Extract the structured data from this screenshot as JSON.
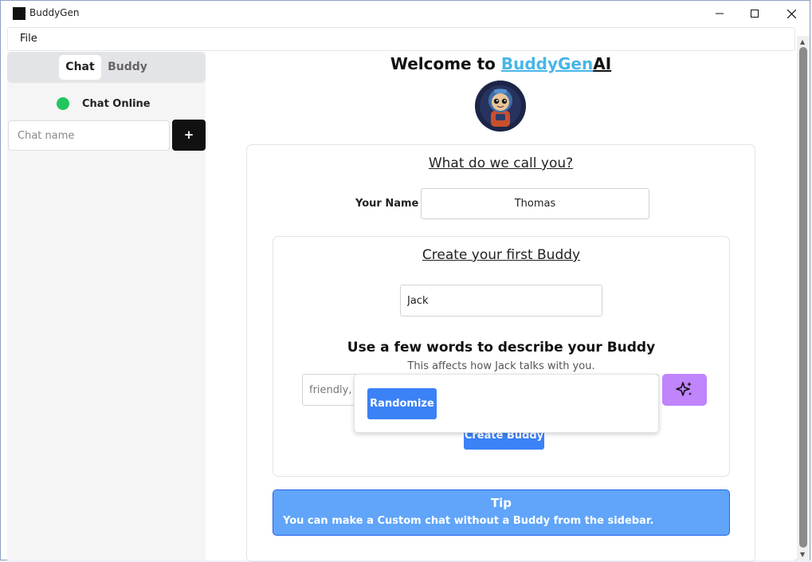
{
  "window": {
    "title": "BuddyGen"
  },
  "menu": {
    "file": "File"
  },
  "sidebar": {
    "tabs": [
      "Chat",
      "Buddy"
    ],
    "status_label": "Chat Online",
    "status_color": "#22c55e",
    "chat_name_placeholder": "Chat name",
    "add_button": "+"
  },
  "main": {
    "welcome_prefix": "Welcome to ",
    "brand_part1": "BuddyGen",
    "brand_part2": "AI",
    "call_heading": "What do we call you?",
    "name_label": "Your Name",
    "name_value": "Thomas",
    "create_heading": "Create your first Buddy",
    "buddy_name_value": "Jack",
    "describe_heading": "Use a few words to describe your Buddy",
    "describe_sub": "This affects how Jack talks with you.",
    "describe_placeholder": "friendly, l",
    "sparkle_icon": "sparkles-icon",
    "create_button": "Create Buddy",
    "randomize_button": "Randomize",
    "tip_title": "Tip",
    "tip_text": "You can make a Custom chat without a Buddy from the sidebar."
  },
  "colors": {
    "accent": "#3b82f6",
    "brand": "#47b6e8",
    "purple": "#c084fc",
    "tip": "#60a5fa"
  }
}
